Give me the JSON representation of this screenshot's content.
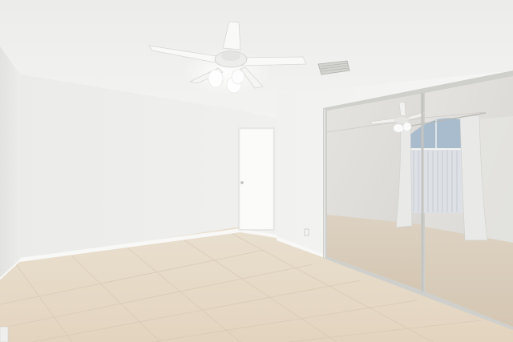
{
  "scene": {
    "room": "empty bedroom",
    "colors": {
      "ceiling": "#efefed",
      "wall_left": "#ededeb",
      "wall_right": "#f2f2f0",
      "floor": "#e6d9c7",
      "baseboard": "#f7f7f5",
      "mirror_tint": "#d6d4d0",
      "curtain": "#e7e7e5",
      "window_blue": "#9fb4c8"
    },
    "objects": [
      "ceiling-fan",
      "hvac-vent",
      "interior-door",
      "mirrored-closet-doors",
      "tile-floor",
      "power-outlet"
    ]
  }
}
